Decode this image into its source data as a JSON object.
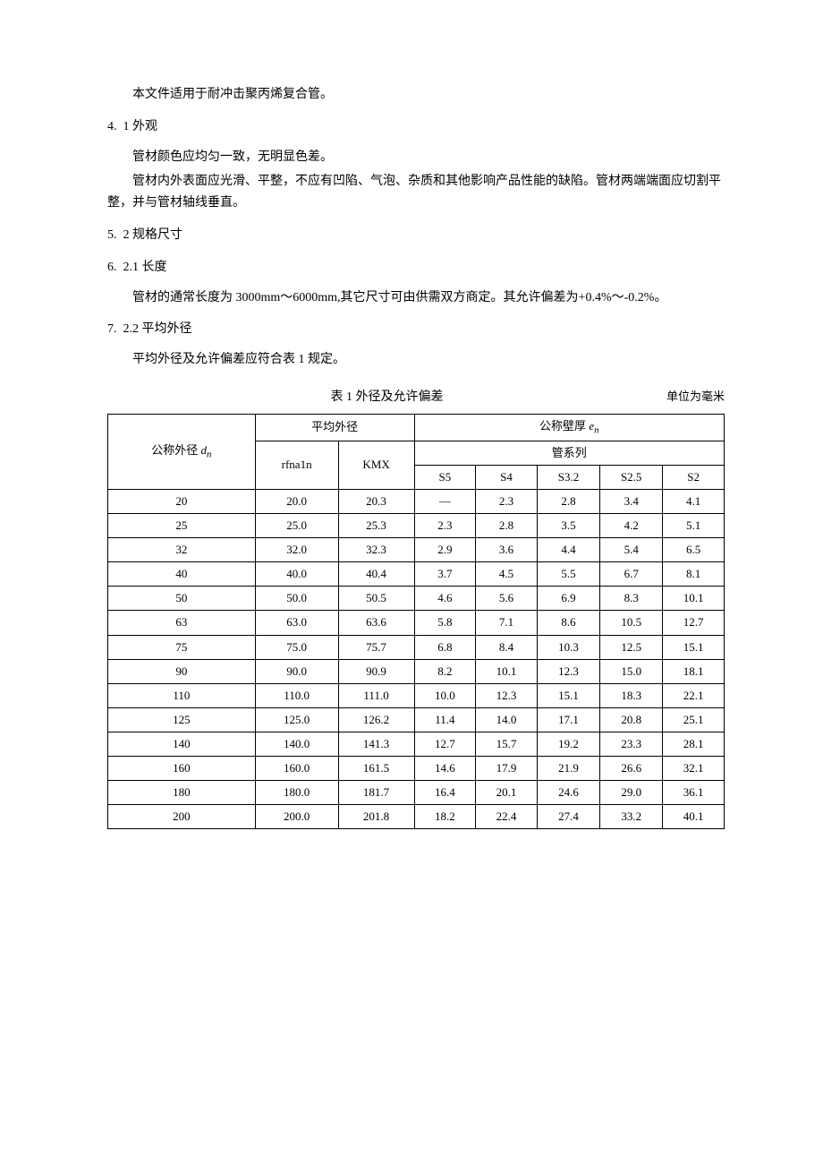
{
  "intro": "本文件适用于耐冲击聚丙烯复合管。",
  "sec4": {
    "num": "4.",
    "title": "1 外观"
  },
  "appearance": {
    "p1": "管材颜色应均匀一致，无明显色差。",
    "p2": "管材内外表面应光滑、平整，不应有凹陷、气泡、杂质和其他影响产品性能的缺陷。管材两端端面应切割平整，并与管材轴线垂直。"
  },
  "sec5": {
    "num": "5.",
    "title": "2 规格尺寸"
  },
  "sec6": {
    "num": "6.",
    "title": "2.1 长度"
  },
  "length_para": "管材的通常长度为 3000mm～6000mm,其它尺寸可由供需双方商定。其允许偏差为+0.4%～-0.2%。",
  "sec7": {
    "num": "7.",
    "title": "2.2 平均外径"
  },
  "avg_od_para": "平均外径及允许偏差应符合表 1 规定。",
  "table1": {
    "title": "表 1 外径及允许偏差",
    "unit": "单位为毫米",
    "header": {
      "col_dn_pre": "公称外径 ",
      "col_dn_var": "d",
      "col_dn_sub": "n",
      "avg_od": "平均外径",
      "en_pre": "公称壁厚 ",
      "en_var": "e",
      "en_sub": "n",
      "series": "管系列",
      "rfn": "rfna1n",
      "kmx": "KMX",
      "s5": "S5",
      "s4": "S4",
      "s32": "S3.2",
      "s25": "S2.5",
      "s2": "S2"
    },
    "rows": [
      {
        "dn": "20",
        "min": "20.0",
        "max": "20.3",
        "s5": "—",
        "s4": "2.3",
        "s32": "2.8",
        "s25": "3.4",
        "s2": "4.1"
      },
      {
        "dn": "25",
        "min": "25.0",
        "max": "25.3",
        "s5": "2.3",
        "s4": "2.8",
        "s32": "3.5",
        "s25": "4.2",
        "s2": "5.1"
      },
      {
        "dn": "32",
        "min": "32.0",
        "max": "32.3",
        "s5": "2.9",
        "s4": "3.6",
        "s32": "4.4",
        "s25": "5.4",
        "s2": "6.5"
      },
      {
        "dn": "40",
        "min": "40.0",
        "max": "40.4",
        "s5": "3.7",
        "s4": "4.5",
        "s32": "5.5",
        "s25": "6.7",
        "s2": "8.1"
      },
      {
        "dn": "50",
        "min": "50.0",
        "max": "50.5",
        "s5": "4.6",
        "s4": "5.6",
        "s32": "6.9",
        "s25": "8.3",
        "s2": "10.1"
      },
      {
        "dn": "63",
        "min": "63.0",
        "max": "63.6",
        "s5": "5.8",
        "s4": "7.1",
        "s32": "8.6",
        "s25": "10.5",
        "s2": "12.7"
      },
      {
        "dn": "75",
        "min": "75.0",
        "max": "75.7",
        "s5": "6.8",
        "s4": "8.4",
        "s32": "10.3",
        "s25": "12.5",
        "s2": "15.1"
      },
      {
        "dn": "90",
        "min": "90.0",
        "max": "90.9",
        "s5": "8.2",
        "s4": "10.1",
        "s32": "12.3",
        "s25": "15.0",
        "s2": "18.1"
      },
      {
        "dn": "110",
        "min": "110.0",
        "max": "111.0",
        "s5": "10.0",
        "s4": "12.3",
        "s32": "15.1",
        "s25": "18.3",
        "s2": "22.1"
      },
      {
        "dn": "125",
        "min": "125.0",
        "max": "126.2",
        "s5": "11.4",
        "s4": "14.0",
        "s32": "17.1",
        "s25": "20.8",
        "s2": "25.1"
      },
      {
        "dn": "140",
        "min": "140.0",
        "max": "141.3",
        "s5": "12.7",
        "s4": "15.7",
        "s32": "19.2",
        "s25": "23.3",
        "s2": "28.1"
      },
      {
        "dn": "160",
        "min": "160.0",
        "max": "161.5",
        "s5": "14.6",
        "s4": "17.9",
        "s32": "21.9",
        "s25": "26.6",
        "s2": "32.1"
      },
      {
        "dn": "180",
        "min": "180.0",
        "max": "181.7",
        "s5": "16.4",
        "s4": "20.1",
        "s32": "24.6",
        "s25": "29.0",
        "s2": "36.1"
      },
      {
        "dn": "200",
        "min": "200.0",
        "max": "201.8",
        "s5": "18.2",
        "s4": "22.4",
        "s32": "27.4",
        "s25": "33.2",
        "s2": "40.1"
      }
    ]
  }
}
